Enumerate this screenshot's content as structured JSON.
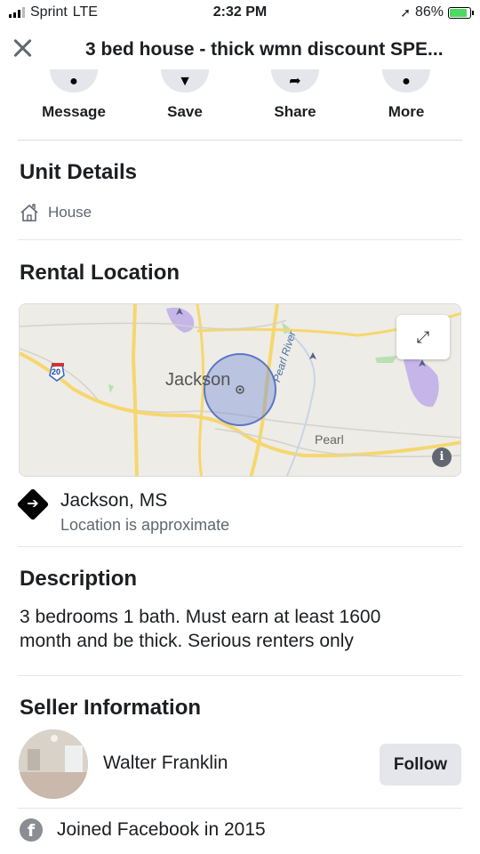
{
  "status_bar": {
    "carrier": "Sprint",
    "network": "LTE",
    "time": "2:32 PM",
    "battery": "86%",
    "battery_level": 0.86
  },
  "header": {
    "title": "3 bed house - thick wmn discount SPE..."
  },
  "actions": [
    {
      "label": "Message",
      "icon": "messenger-icon"
    },
    {
      "label": "Save",
      "icon": "bookmark-icon"
    },
    {
      "label": "Share",
      "icon": "share-arrow-icon"
    },
    {
      "label": "More",
      "icon": "more-dots-icon"
    }
  ],
  "unit_details": {
    "title": "Unit Details",
    "type": "House"
  },
  "rental_location": {
    "title": "Rental Location",
    "map": {
      "labels": {
        "city": "Jackson",
        "river": "Pearl River",
        "town": "Pearl",
        "highway": "20"
      }
    },
    "city": "Jackson, MS",
    "note": "Location is approximate"
  },
  "description": {
    "title": "Description",
    "text": "3 bedrooms 1 bath. Must earn at least 1600 month and be thick. Serious renters only"
  },
  "seller": {
    "title": "Seller Information",
    "name": "Walter Franklin",
    "follow_label": "Follow",
    "joined": "Joined Facebook in 2015"
  },
  "colors": {
    "accent_gray": "#e4e6eb",
    "text_primary": "#1c1e21",
    "text_secondary": "#606770",
    "map_road": "#f5d76e",
    "map_circle": "#7b93d6"
  }
}
